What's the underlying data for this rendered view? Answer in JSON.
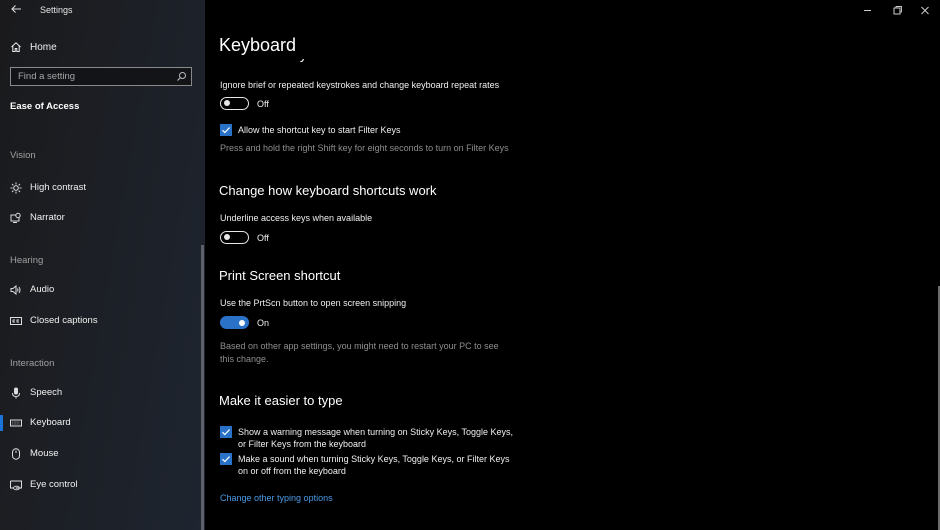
{
  "window": {
    "app_title": "Settings",
    "controls": {
      "minimize": "minimize-icon",
      "restore": "restore-icon",
      "close": "close-icon"
    }
  },
  "sidebar": {
    "back_icon": "back-arrow-icon",
    "home_label": "Home",
    "search_placeholder": "Find a setting",
    "section_title": "Ease of Access",
    "groups": [
      {
        "header": "Vision",
        "items": [
          {
            "label": "High contrast",
            "icon": "brightness-icon"
          },
          {
            "label": "Narrator",
            "icon": "narrator-icon"
          }
        ]
      },
      {
        "header": "Hearing",
        "items": [
          {
            "label": "Audio",
            "icon": "speaker-icon"
          },
          {
            "label": "Closed captions",
            "icon": "closed-captions-icon"
          }
        ]
      },
      {
        "header": "Interaction",
        "items": [
          {
            "label": "Speech",
            "icon": "microphone-icon"
          },
          {
            "label": "Keyboard",
            "icon": "keyboard-icon",
            "selected": true
          },
          {
            "label": "Mouse",
            "icon": "mouse-icon"
          },
          {
            "label": "Eye control",
            "icon": "eye-control-icon"
          }
        ]
      }
    ]
  },
  "main": {
    "page_title": "Keyboard",
    "filter_keys": {
      "heading_partial": "Use Filter Keys",
      "description": "Ignore brief or repeated keystrokes and change keyboard repeat rates",
      "toggle_state": "Off",
      "toggle_on": false,
      "shortcut_checkbox_label": "Allow the shortcut key to start Filter Keys",
      "shortcut_checked": true,
      "shortcut_hint": "Press and hold the right Shift key for eight seconds to turn on Filter Keys"
    },
    "shortcuts": {
      "heading": "Change how keyboard shortcuts work",
      "underline_label": "Underline access keys when available",
      "toggle_state": "Off",
      "toggle_on": false
    },
    "print_screen": {
      "heading": "Print Screen shortcut",
      "label": "Use the PrtScn button to open screen snipping",
      "toggle_state": "On",
      "toggle_on": true,
      "note_line1": "Based on other app settings, you might need to restart your PC to see",
      "note_line2": "this change."
    },
    "easier_typing": {
      "heading": "Make it easier to type",
      "checkbox1_line1": "Show a warning message when turning on Sticky Keys, Toggle Keys,",
      "checkbox1_line2": "or Filter Keys from the keyboard",
      "checkbox1_checked": true,
      "checkbox2_line1": "Make a sound when turning Sticky Keys, Toggle Keys, or Filter Keys",
      "checkbox2_line2": "on or off from the keyboard",
      "checkbox2_checked": true,
      "link": "Change other typing options"
    }
  },
  "colors": {
    "accent": "#2a72c8",
    "link": "#4a9ae6",
    "selection_bar": "#1a73d9"
  }
}
